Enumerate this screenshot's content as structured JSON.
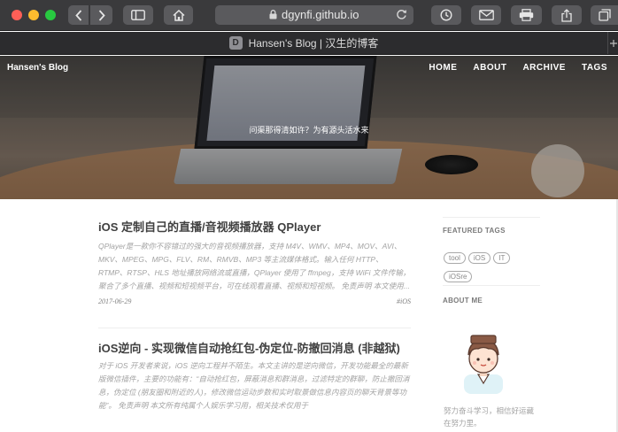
{
  "browser": {
    "url": "dgynfi.github.io",
    "tab_title": "Hansen's Blog | 汉生的博客",
    "favicon_letter": "D",
    "icons": [
      "chevron-left-icon",
      "chevron-right-icon",
      "sidebar-icon",
      "home-icon",
      "lock-icon",
      "reload-icon",
      "clock-icon",
      "mail-icon",
      "print-icon",
      "share-icon",
      "tabs-icon"
    ]
  },
  "site": {
    "brand": "Hansen's Blog",
    "nav": [
      "HOME",
      "ABOUT",
      "ARCHIVE",
      "TAGS"
    ],
    "subtitle": "问渠那得清如许？为有源头活水来"
  },
  "posts": [
    {
      "title": "iOS 定制自己的直播/音视频播放器 QPlayer",
      "excerpt": "QPlayer是一款你不容错过的强大的音视频播放器，支持 M4V、WMV、MP4、MOV、AVI、MKV、MPEG、MPG、FLV、RM、RMVB、MP3 等主流媒体格式。输入任何 HTTP、RTMP、RTSP、HLS 地址播放网络流或直播，QPlayer 使用了 ffmpeg，支持 WiFi 文件传输，聚合了多个直播、视频和短视频平台，可在线观看直播、视频和短视频。 免责声明 本文使用...",
      "date": "2017-06-29",
      "tag": "#iOS"
    },
    {
      "title": "iOS逆向 - 实现微信自动抢红包-伪定位-防撤回消息 (非越狱)",
      "excerpt": "对于 iOS 开发者来说，iOS 逆向工程并不陌生。本文主讲的是逆向微信，开发功能最全的最新版微信插件，主要的功能有：“自动抢红包，屏蔽消息和群消息，过滤特定的群聊，防止撤回消息，伪定位 (朋友圈和附近的人)，修改微信运动步数和实时取景做信息内容页的聊天背景等功能”。 免责声明 本文所有纯属个人娱乐学习用，相关技术仅用于"
    }
  ],
  "sidebar": {
    "featured_tags_heading": "FEATURED TAGS",
    "tags": [
      "tool",
      "iOS",
      "IT",
      "iOSre"
    ],
    "about_heading": "ABOUT ME",
    "about_text": "努力奋斗学习，相信好运藏在努力里。"
  }
}
